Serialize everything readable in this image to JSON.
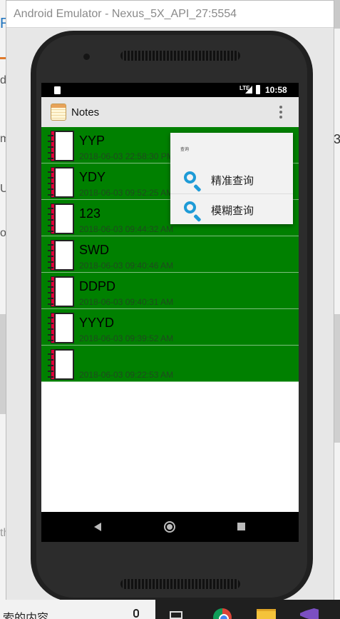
{
  "emulator": {
    "window_title": "Android Emulator - Nexus_5X_API_27:5554"
  },
  "status_bar": {
    "network": "LTE",
    "time": "10:58"
  },
  "action_bar": {
    "title": "Notes",
    "overflow_icon": "more-vert-icon"
  },
  "notes": [
    {
      "title": "YYP",
      "date": "2018-06-03 22:58:30 PM"
    },
    {
      "title": "YDY",
      "date": "2018-06-03 09:52:25 AM"
    },
    {
      "title": "123",
      "date": "2018-06-03 09:44:32 AM"
    },
    {
      "title": "SWD",
      "date": "2018-06-03 09:40:46 AM"
    },
    {
      "title": "DDPD",
      "date": "2018-06-03 09:40:31 AM"
    },
    {
      "title": "YYYD",
      "date": "2018-06-03 09:39:52 AM"
    },
    {
      "title": "",
      "date": "2018-06-03 09:22:53 AM"
    }
  ],
  "popup_menu": {
    "header": "查询",
    "items": [
      {
        "label": "精准查询",
        "icon": "search-icon"
      },
      {
        "label": "模糊查询",
        "icon": "search-icon"
      }
    ]
  },
  "taskbar": {
    "search_text": "索的内容"
  },
  "background": {
    "left_texts": [
      "R",
      "de",
      "m",
      "U",
      "ou",
      "th"
    ],
    "right_text": "3"
  },
  "colors": {
    "row_bg": "#008000",
    "menu_icon": "#1e9bd7",
    "status_bar": "#000000"
  }
}
